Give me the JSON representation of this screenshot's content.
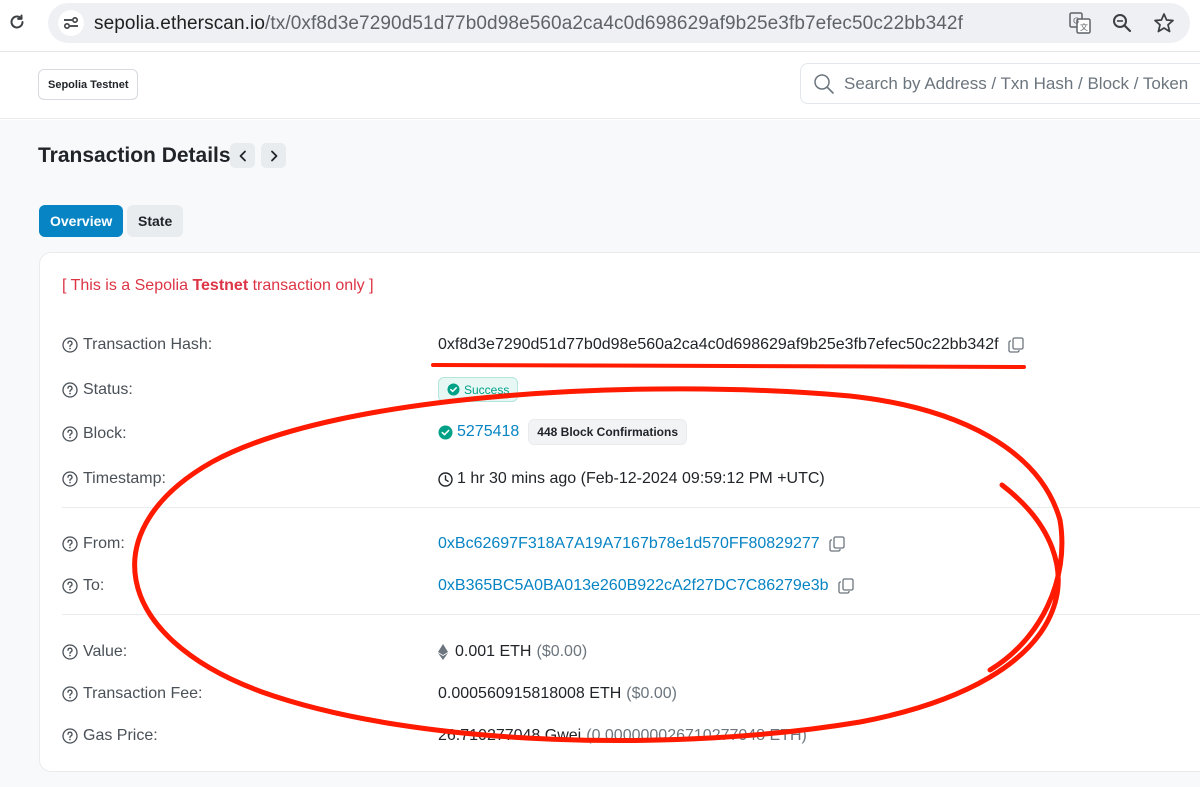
{
  "browser": {
    "url_domain": "sepolia.etherscan.io",
    "url_path": "/tx/0xf8d3e7290d51d77b0d98e560a2ca4c0d698629af9b25e3fb7efec50c22bb342f"
  },
  "header": {
    "network_badge": "Sepolia Testnet",
    "search_placeholder": "Search by Address / Txn Hash / Block / Token"
  },
  "page": {
    "title": "Transaction Details",
    "tabs": [
      {
        "label": "Overview",
        "active": true
      },
      {
        "label": "State",
        "active": false
      }
    ]
  },
  "details": {
    "testnet_note": {
      "prefix": "[ This is a Sepolia ",
      "bold": "Testnet",
      "suffix": " transaction only ]"
    },
    "rows": {
      "hash": {
        "label": "Transaction Hash:",
        "value": "0xf8d3e7290d51d77b0d98e560a2ca4c0d698629af9b25e3fb7efec50c22bb342f"
      },
      "status": {
        "label": "Status:",
        "value": "Success"
      },
      "block": {
        "label": "Block:",
        "value": "5275418",
        "confirmations": "448 Block Confirmations"
      },
      "timestamp": {
        "label": "Timestamp:",
        "value": "1 hr 30 mins ago (Feb-12-2024 09:59:12 PM +UTC)"
      },
      "from": {
        "label": "From:",
        "value": "0xBc62697F318A7A19A7167b78e1d570FF80829277"
      },
      "to": {
        "label": "To:",
        "value": "0xB365BC5A0BA013e260B922cA2f27DC7C86279e3b"
      },
      "value": {
        "label": "Value:",
        "amount": "0.001 ETH",
        "usd": "($0.00)"
      },
      "fee": {
        "label": "Transaction Fee:",
        "amount": "0.000560915818008 ETH",
        "usd": "($0.00)"
      },
      "gas": {
        "label": "Gas Price:",
        "amount": "26.710277048 Gwei",
        "eth": "(0.000000026710277048 ETH)"
      }
    }
  },
  "colors": {
    "link": "#0784c3",
    "success": "#00a186",
    "testnet_red": "#dc3545",
    "annotation_red": "#ff1a00"
  }
}
